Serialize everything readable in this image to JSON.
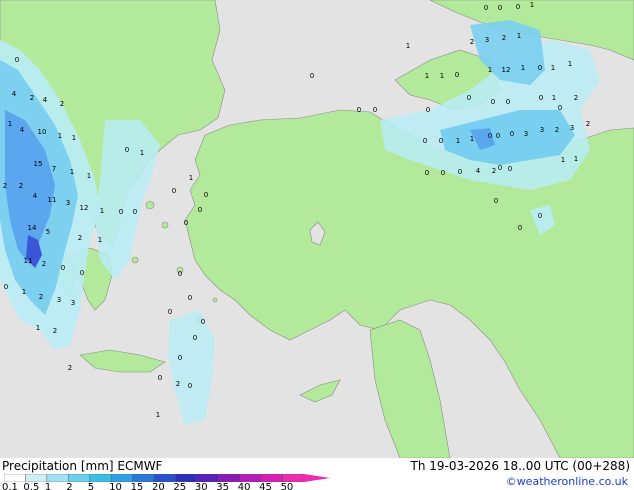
{
  "header": {
    "title_left": "Precipitation [mm] ECMWF",
    "title_right": "Th 19-03-2026 18..00 UTC (00+288)",
    "copyright": "©weatheronline.co.uk"
  },
  "colors": {
    "sea": "#e3e3e3",
    "land": "#b3e99a",
    "border": "#8c8c8c",
    "precip_light": "#b8ecf6",
    "precip_mid": "#79cfef",
    "precip_blue": "#5aa7f0",
    "precip_dark": "#3b56d8"
  },
  "legend": {
    "labels": [
      "0.1",
      "0.5",
      "1",
      "2",
      "5",
      "10",
      "15",
      "20",
      "25",
      "30",
      "35",
      "40",
      "45",
      "50"
    ],
    "colors": [
      "#ffffff",
      "#cfeff6",
      "#9ee2f3",
      "#69d1f0",
      "#3cbde8",
      "#2ea0e5",
      "#2a79d8",
      "#2b4fce",
      "#2d2fb8",
      "#5a1fb8",
      "#8a1ab8",
      "#b41eb6",
      "#d51fb0",
      "#ee2ab0"
    ]
  },
  "map_values": [
    {
      "v": "0"
    },
    {
      "v": "0"
    },
    {
      "v": "0"
    },
    {
      "v": "1"
    },
    {
      "v": "2"
    },
    {
      "v": "3"
    },
    {
      "v": "2"
    },
    {
      "v": "1"
    },
    {
      "v": "1"
    },
    {
      "v": "0"
    },
    {
      "v": "1"
    },
    {
      "v": "1"
    },
    {
      "v": "0"
    },
    {
      "v": "1"
    },
    {
      "v": "12"
    },
    {
      "v": "1"
    },
    {
      "v": "0"
    },
    {
      "v": "1"
    },
    {
      "v": "1"
    },
    {
      "v": "0"
    },
    {
      "v": "0"
    },
    {
      "v": "0"
    },
    {
      "v": "0"
    },
    {
      "v": "0"
    },
    {
      "v": "0"
    },
    {
      "v": "0"
    },
    {
      "v": "1"
    },
    {
      "v": "2"
    },
    {
      "v": "0"
    },
    {
      "v": "0"
    },
    {
      "v": "0"
    },
    {
      "v": "1"
    },
    {
      "v": "1"
    },
    {
      "v": "0"
    },
    {
      "v": "0"
    },
    {
      "v": "0"
    },
    {
      "v": "3"
    },
    {
      "v": "3"
    },
    {
      "v": "2"
    },
    {
      "v": "3"
    },
    {
      "v": "2"
    },
    {
      "v": "1"
    },
    {
      "v": "1"
    },
    {
      "v": "0"
    },
    {
      "v": "0"
    },
    {
      "v": "0"
    },
    {
      "v": "4"
    },
    {
      "v": "2"
    },
    {
      "v": "0"
    },
    {
      "v": "0"
    },
    {
      "v": "1"
    },
    {
      "v": "0"
    },
    {
      "v": "0"
    },
    {
      "v": "0"
    },
    {
      "v": "0"
    },
    {
      "v": "0"
    },
    {
      "v": "0"
    },
    {
      "v": "0"
    },
    {
      "v": "4"
    },
    {
      "v": "2"
    },
    {
      "v": "4"
    },
    {
      "v": "2"
    },
    {
      "v": "10"
    },
    {
      "v": "1"
    },
    {
      "v": "1"
    },
    {
      "v": "1"
    },
    {
      "v": "4"
    },
    {
      "v": "15"
    },
    {
      "v": "7"
    },
    {
      "v": "1"
    },
    {
      "v": "1"
    },
    {
      "v": "2"
    },
    {
      "v": "2"
    },
    {
      "v": "4"
    },
    {
      "v": "11"
    },
    {
      "v": "3"
    },
    {
      "v": "12"
    },
    {
      "v": "1"
    },
    {
      "v": "1"
    },
    {
      "v": "0"
    },
    {
      "v": "14"
    },
    {
      "v": "5"
    },
    {
      "v": "2"
    },
    {
      "v": "1"
    },
    {
      "v": "11"
    },
    {
      "v": "2"
    },
    {
      "v": "0"
    },
    {
      "v": "0"
    },
    {
      "v": "0"
    },
    {
      "v": "1"
    },
    {
      "v": "2"
    },
    {
      "v": "3"
    },
    {
      "v": "3"
    },
    {
      "v": "1"
    },
    {
      "v": "2"
    },
    {
      "v": "2"
    },
    {
      "v": "0"
    },
    {
      "v": "2"
    },
    {
      "v": "0"
    },
    {
      "v": "0"
    },
    {
      "v": "1"
    },
    {
      "v": "0"
    },
    {
      "v": "0"
    },
    {
      "v": "0"
    },
    {
      "v": "0"
    },
    {
      "v": "0"
    },
    {
      "v": "0"
    },
    {
      "v": "0"
    },
    {
      "v": "0"
    }
  ]
}
